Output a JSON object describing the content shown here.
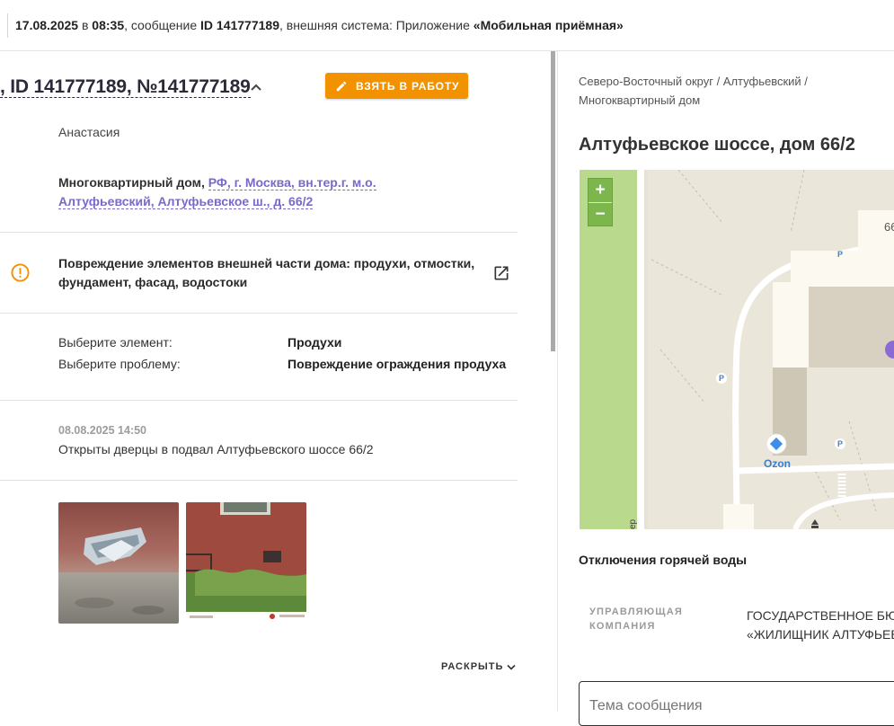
{
  "topbar": {
    "date": "17.08.2025",
    "at": " в ",
    "time": "08:35",
    "msg_prefix": ", сообщение ",
    "msg_id": "ID 141777189",
    "system_prefix": ", внешняя система: Приложение ",
    "system_name": "«Мобильная приёмная»"
  },
  "ticket": {
    "title": ", ID 141777189, №141777189",
    "take_button": "ВЗЯТЬ В РАБОТУ",
    "author": "Анастасия",
    "object_type": "Многоквартирный дом, ",
    "object_address": "РФ, г. Москва, вн.тер.г. м.о. Алтуфьевский, Алтуфьевское ш., д. 66/2",
    "problem": "Повреждение элементов внешней части дома: продухи, отмостки, фундамент, фасад, водостоки",
    "fields": [
      {
        "label": "Выберите элемент:",
        "value": "Продухи"
      },
      {
        "label": "Выберите проблему:",
        "value": "Повреждение ограждения продуха"
      }
    ],
    "comment_date": "08.08.2025 14:50",
    "comment_text": "Открыты дверцы в подвал Алтуфьевского шоссе 66/2",
    "expand": "РАСКРЫТЬ"
  },
  "right": {
    "breadcrumb": "Северо-Восточный округ / Алтуфьевский / Многоквартирный дом",
    "address_title": "Алтуфьевское шоссе, дом 66/2",
    "map": {
      "zoom_in": "+",
      "zoom_out": "−",
      "house_number": "66",
      "poi": "Ozon",
      "parking": "P"
    },
    "hot_water_label": "Отключения горячей воды",
    "management_label": "УПРАВЛЯЮЩАЯ КОМПАНИЯ",
    "management_value_line1": "ГОСУДАРСТВЕННОЕ БЮДЖ",
    "management_value_line2": "«ЖИЛИЩНИК АЛТУФЬЕВ",
    "subject_placeholder": "Тема сообщения"
  },
  "colors": {
    "accent_orange": "#f39200",
    "link_purple": "#7b68c8",
    "map_green": "#7db64d"
  }
}
